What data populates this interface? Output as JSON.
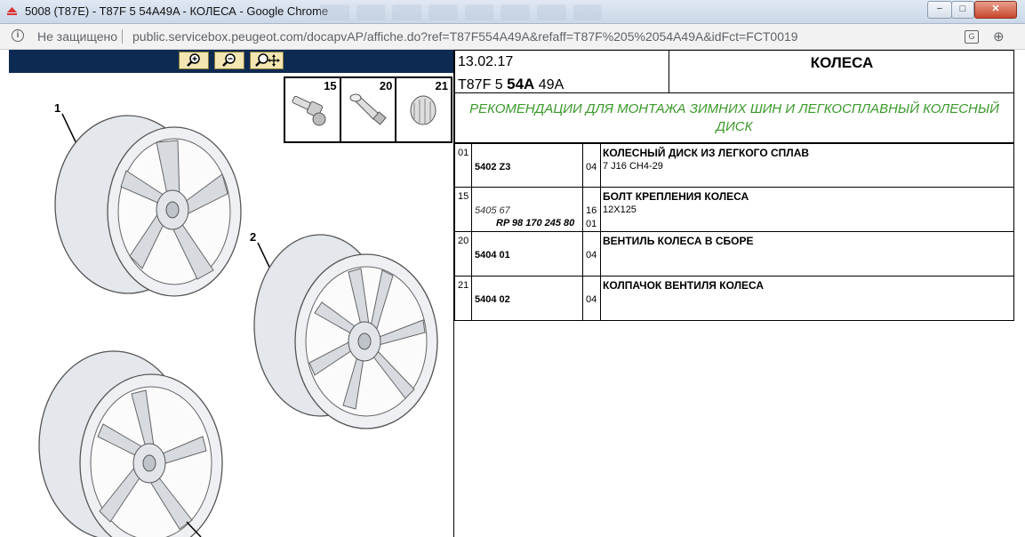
{
  "window": {
    "title": "5008 (T87E) - T87F 5 54A49A - КОЛЕСА - Google Chrome",
    "min_symbol": "−",
    "max_symbol": "□",
    "close_symbol": "✕"
  },
  "address_bar": {
    "security_text": "Не защищено",
    "url": "public.servicebox.peugeot.com/docapvAP/affiche.do?ref=T87F554A49A&refaff=T87F%205%2054A49A&idFct=FCT0019"
  },
  "illustration": {
    "toolbar_buttons": [
      "zoom-in",
      "zoom-out",
      "zoom-pan"
    ],
    "thumbnails": [
      {
        "num": "15"
      },
      {
        "num": "20"
      },
      {
        "num": "21"
      }
    ],
    "callouts": [
      "1",
      "2"
    ]
  },
  "header": {
    "date": "13.02.17",
    "code_prefix": "T87F 5",
    "code_bold": "54A",
    "code_suffix": "49A",
    "title": "КОЛЕСА"
  },
  "recommendation": "РЕКОМЕНДАЦИИ ДЛЯ МОНТАЖА ЗИМНИХ ШИН И ЛЕГКОСПЛАВНЫЙ КОЛЕСНЫЙ ДИСК",
  "parts": [
    {
      "ref": "01",
      "part_no": "5402 Z3",
      "qty": "04",
      "name": "КОЛЕСНЫЙ ДИСК ИЗ ЛЕГКОГО СПЛАВ",
      "desc": "7 J16 CH4-29"
    },
    {
      "ref": "15",
      "part_no_old": "5405 67",
      "part_no_rp": "RP 98 170 245 80",
      "qty": "16",
      "qty2": "01",
      "name": "БОЛТ КРЕПЛЕНИЯ КОЛЕСА",
      "desc": "12X125"
    },
    {
      "ref": "20",
      "part_no": "5404 01",
      "qty": "04",
      "name": "ВЕНТИЛЬ КОЛЕСА В СБОРЕ",
      "desc": ""
    },
    {
      "ref": "21",
      "part_no": "5404 02",
      "qty": "04",
      "name": "КОЛПАЧОК ВЕНТИЛЯ КОЛЕСА",
      "desc": ""
    }
  ]
}
